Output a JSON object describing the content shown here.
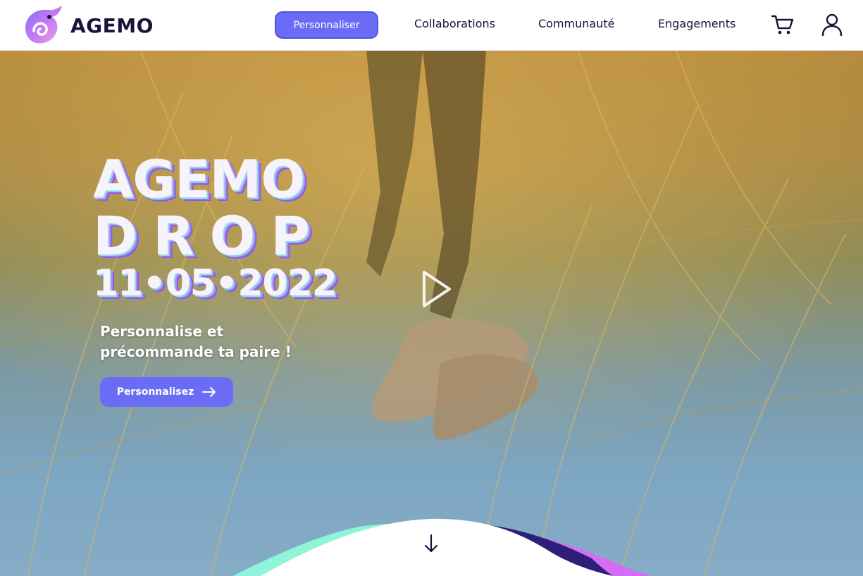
{
  "brand": {
    "name": "AGEMO",
    "logo_icon": "chameleon-logo-icon",
    "colors": {
      "primary": "#6b6cf6",
      "dark": "#17133a",
      "mint": "#8ef5d8",
      "violet": "#d46cf5",
      "navy": "#2d1f78"
    }
  },
  "header": {
    "cta_label": "Personnaliser",
    "nav": [
      {
        "label": "Collaborations"
      },
      {
        "label": "Communauté"
      },
      {
        "label": "Engagements"
      }
    ],
    "icons": [
      "cart-icon",
      "user-icon"
    ]
  },
  "hero": {
    "title_line1": "AGEMO",
    "title_line2": "DROP",
    "date": "11•05•2022",
    "subtitle_line1": "Personnalise et",
    "subtitle_line2": "précommande ta paire !",
    "cta_label": "Personnalisez",
    "icons": [
      "play-icon",
      "arrow-right-icon",
      "arrow-down-icon"
    ]
  }
}
